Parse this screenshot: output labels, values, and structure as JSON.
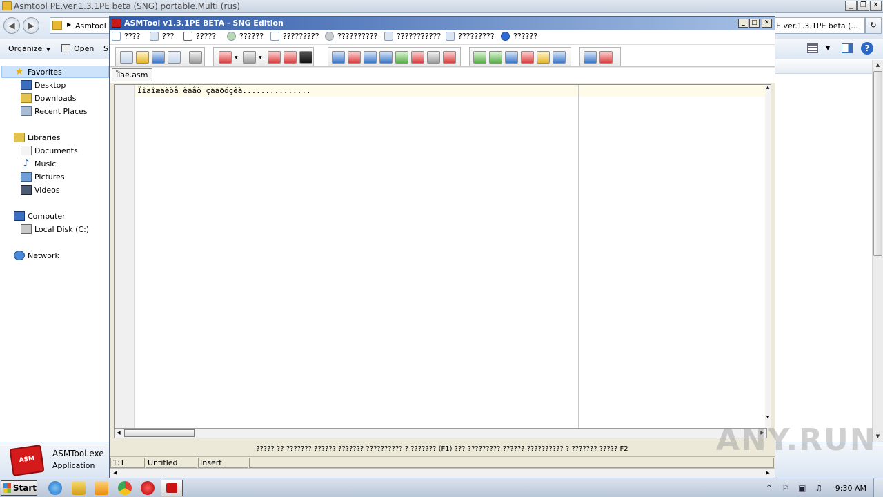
{
  "explorer": {
    "title": "Asmtool PE.ver.1.3.1PE beta (SNG) portable.Multi (rus)",
    "address_segment": "Asmtool F",
    "address_right": "E.ver.1.3.1PE beta (...",
    "toolbar": {
      "organize_label": "Organize",
      "open_label": "Open",
      "partial_label": "S"
    },
    "nav": {
      "favorites": "Favorites",
      "desktop": "Desktop",
      "downloads": "Downloads",
      "recent": "Recent Places",
      "libraries": "Libraries",
      "documents": "Documents",
      "music": "Music",
      "pictures": "Pictures",
      "videos": "Videos",
      "computer": "Computer",
      "local_disk": "Local Disk (C:)",
      "network": "Network"
    },
    "details": {
      "name": "ASMTool.exe",
      "type": "Application",
      "icon_text": "ASM"
    }
  },
  "asmtool": {
    "title": "ASMTool v1.3.1PE BETA - SNG Edition",
    "menu": [
      "????",
      "???",
      "?????",
      "??????",
      "?????????",
      "??????????",
      "???????????",
      "?????????",
      "??????"
    ],
    "tab_name": "Ïîäë.asm",
    "code_line": "Ïîäîæäèòå èäåò çàãðóçêà...............",
    "hint": "????? ?? ??????? ?????? ??????? ?????????? ? ??????? (F1) ??? ????????? ?????? ?????????? ? ??????? ????? F2",
    "status": {
      "position": "1:1",
      "file": "Untitled",
      "mode": "Insert"
    }
  },
  "taskbar": {
    "start_label": "Start",
    "clock": "9:30 AM"
  },
  "watermark": "ANY.RUN"
}
